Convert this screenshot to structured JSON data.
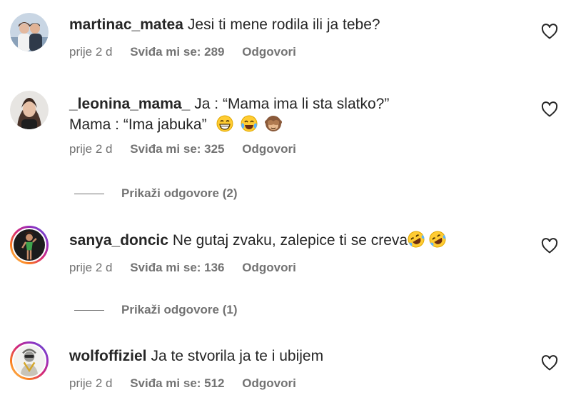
{
  "comments": [
    {
      "username": "martinac_matea",
      "text": "Jesi ti mene rodila ili ja tebe?",
      "time": "prije 2 d",
      "likes": "Sviđa mi se: 289",
      "reply": "Odgovori",
      "avatar_icon": "couple-photo-avatar",
      "story_ring": false
    },
    {
      "username": "_leonina_mama_",
      "text": "Ja : “Mama ima li sta slatko?”",
      "text_line2": "Mama : “Ima jabuka”",
      "emojis": [
        "grinning-face-icon",
        "tears-of-joy-icon",
        "see-no-evil-monkey-icon"
      ],
      "time": "prije 2 d",
      "likes": "Sviđa mi se: 325",
      "reply": "Odgovori",
      "avatar_icon": "woman-portrait-avatar",
      "story_ring": false,
      "view_replies": "Prikaži odgovore (2)"
    },
    {
      "username": "sanya_doncic",
      "text": "Ne gutaj zvaku, zalepice ti se creva",
      "emojis": [
        "rolling-on-floor-laughing-icon",
        "rolling-on-floor-laughing-icon"
      ],
      "time": "prije 2 d",
      "likes": "Sviđa mi se: 136",
      "reply": "Odgovori",
      "avatar_icon": "woman-green-outfit-avatar",
      "story_ring": true,
      "view_replies": "Prikaži odgovore (1)"
    },
    {
      "username": "wolfoffiziel",
      "text": "Ja te stvorila ja te i ubijem",
      "time": "prije 2 d",
      "likes": "Sviđa mi se: 512",
      "reply": "Odgovori",
      "avatar_icon": "costumed-figure-avatar",
      "story_ring": true
    }
  ],
  "colors": {
    "text": "#262626",
    "muted": "#737373",
    "story_ring": [
      "#feda75",
      "#fa7e1e",
      "#d62976",
      "#962fbf",
      "#4f5bd5"
    ],
    "emoji_yellow": "#ffcc33"
  },
  "icons": {
    "like": "heart-outline-icon"
  }
}
